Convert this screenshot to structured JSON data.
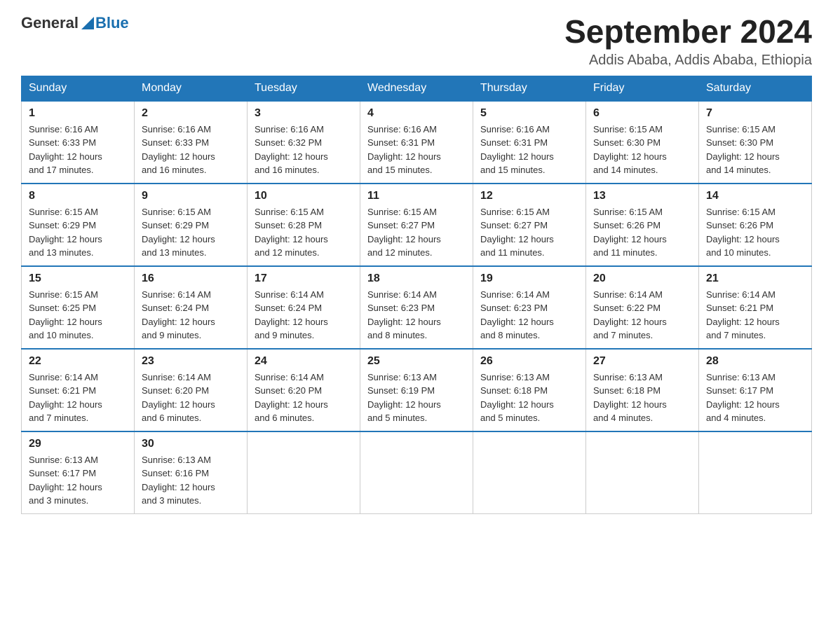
{
  "header": {
    "logo_general": "General",
    "logo_blue": "Blue",
    "title": "September 2024",
    "subtitle": "Addis Ababa, Addis Ababa, Ethiopia"
  },
  "weekdays": [
    "Sunday",
    "Monday",
    "Tuesday",
    "Wednesday",
    "Thursday",
    "Friday",
    "Saturday"
  ],
  "weeks": [
    [
      {
        "day": "1",
        "sunrise": "6:16 AM",
        "sunset": "6:33 PM",
        "daylight": "12 hours and 17 minutes."
      },
      {
        "day": "2",
        "sunrise": "6:16 AM",
        "sunset": "6:33 PM",
        "daylight": "12 hours and 16 minutes."
      },
      {
        "day": "3",
        "sunrise": "6:16 AM",
        "sunset": "6:32 PM",
        "daylight": "12 hours and 16 minutes."
      },
      {
        "day": "4",
        "sunrise": "6:16 AM",
        "sunset": "6:31 PM",
        "daylight": "12 hours and 15 minutes."
      },
      {
        "day": "5",
        "sunrise": "6:16 AM",
        "sunset": "6:31 PM",
        "daylight": "12 hours and 15 minutes."
      },
      {
        "day": "6",
        "sunrise": "6:15 AM",
        "sunset": "6:30 PM",
        "daylight": "12 hours and 14 minutes."
      },
      {
        "day": "7",
        "sunrise": "6:15 AM",
        "sunset": "6:30 PM",
        "daylight": "12 hours and 14 minutes."
      }
    ],
    [
      {
        "day": "8",
        "sunrise": "6:15 AM",
        "sunset": "6:29 PM",
        "daylight": "12 hours and 13 minutes."
      },
      {
        "day": "9",
        "sunrise": "6:15 AM",
        "sunset": "6:29 PM",
        "daylight": "12 hours and 13 minutes."
      },
      {
        "day": "10",
        "sunrise": "6:15 AM",
        "sunset": "6:28 PM",
        "daylight": "12 hours and 12 minutes."
      },
      {
        "day": "11",
        "sunrise": "6:15 AM",
        "sunset": "6:27 PM",
        "daylight": "12 hours and 12 minutes."
      },
      {
        "day": "12",
        "sunrise": "6:15 AM",
        "sunset": "6:27 PM",
        "daylight": "12 hours and 11 minutes."
      },
      {
        "day": "13",
        "sunrise": "6:15 AM",
        "sunset": "6:26 PM",
        "daylight": "12 hours and 11 minutes."
      },
      {
        "day": "14",
        "sunrise": "6:15 AM",
        "sunset": "6:26 PM",
        "daylight": "12 hours and 10 minutes."
      }
    ],
    [
      {
        "day": "15",
        "sunrise": "6:15 AM",
        "sunset": "6:25 PM",
        "daylight": "12 hours and 10 minutes."
      },
      {
        "day": "16",
        "sunrise": "6:14 AM",
        "sunset": "6:24 PM",
        "daylight": "12 hours and 9 minutes."
      },
      {
        "day": "17",
        "sunrise": "6:14 AM",
        "sunset": "6:24 PM",
        "daylight": "12 hours and 9 minutes."
      },
      {
        "day": "18",
        "sunrise": "6:14 AM",
        "sunset": "6:23 PM",
        "daylight": "12 hours and 8 minutes."
      },
      {
        "day": "19",
        "sunrise": "6:14 AM",
        "sunset": "6:23 PM",
        "daylight": "12 hours and 8 minutes."
      },
      {
        "day": "20",
        "sunrise": "6:14 AM",
        "sunset": "6:22 PM",
        "daylight": "12 hours and 7 minutes."
      },
      {
        "day": "21",
        "sunrise": "6:14 AM",
        "sunset": "6:21 PM",
        "daylight": "12 hours and 7 minutes."
      }
    ],
    [
      {
        "day": "22",
        "sunrise": "6:14 AM",
        "sunset": "6:21 PM",
        "daylight": "12 hours and 7 minutes."
      },
      {
        "day": "23",
        "sunrise": "6:14 AM",
        "sunset": "6:20 PM",
        "daylight": "12 hours and 6 minutes."
      },
      {
        "day": "24",
        "sunrise": "6:14 AM",
        "sunset": "6:20 PM",
        "daylight": "12 hours and 6 minutes."
      },
      {
        "day": "25",
        "sunrise": "6:13 AM",
        "sunset": "6:19 PM",
        "daylight": "12 hours and 5 minutes."
      },
      {
        "day": "26",
        "sunrise": "6:13 AM",
        "sunset": "6:18 PM",
        "daylight": "12 hours and 5 minutes."
      },
      {
        "day": "27",
        "sunrise": "6:13 AM",
        "sunset": "6:18 PM",
        "daylight": "12 hours and 4 minutes."
      },
      {
        "day": "28",
        "sunrise": "6:13 AM",
        "sunset": "6:17 PM",
        "daylight": "12 hours and 4 minutes."
      }
    ],
    [
      {
        "day": "29",
        "sunrise": "6:13 AM",
        "sunset": "6:17 PM",
        "daylight": "12 hours and 3 minutes."
      },
      {
        "day": "30",
        "sunrise": "6:13 AM",
        "sunset": "6:16 PM",
        "daylight": "12 hours and 3 minutes."
      },
      null,
      null,
      null,
      null,
      null
    ]
  ],
  "labels": {
    "sunrise": "Sunrise:",
    "sunset": "Sunset:",
    "daylight": "Daylight:"
  }
}
